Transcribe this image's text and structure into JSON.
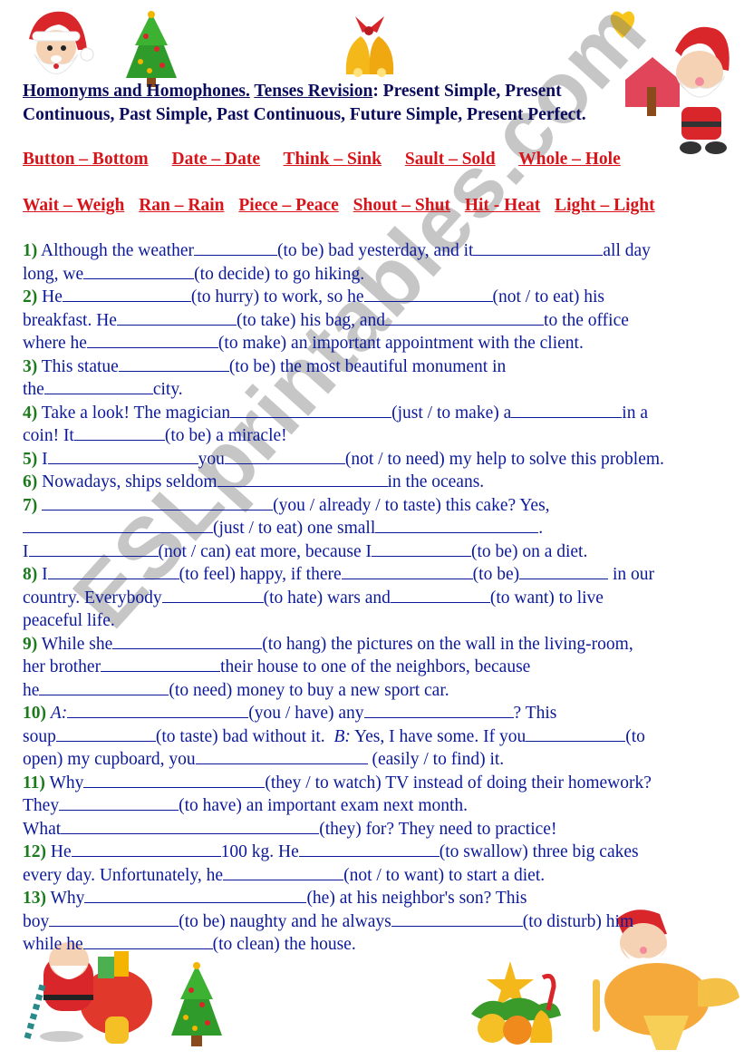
{
  "title": {
    "part1": "Homonyms and Homophones.",
    "part2": "Tenses Revision",
    "part3": ": Present Simple, Present",
    "line2": "Continuous, Past Simple, Past Continuous, Future Simple, Present Perfect."
  },
  "word_pairs": {
    "row1": [
      "Button – Bottom",
      "Date – Date",
      "Think – Sink",
      "Sault – Sold",
      "Whole – Hole"
    ],
    "row2": [
      "Wait – Weigh",
      "Ran – Rain",
      "Piece – Peace",
      "Shout – Shut",
      "Hit - Heat",
      "Light – Light"
    ]
  },
  "watermark": "ESLprintables.com",
  "exercises": {
    "l1": {
      "num": "1)",
      "a": " Although the weather",
      "b": "(to be) bad yesterday, and it",
      "c": "all day"
    },
    "l2": {
      "a": "long, we",
      "b": "(to decide) to go hiking."
    },
    "l3": {
      "num": "2)",
      "a": " He",
      "b": "(to hurry) to work, so he",
      "c": "(not / to eat) his"
    },
    "l4": {
      "a": "breakfast. He",
      "b": "(to take) his bag, and",
      "c": "to the office"
    },
    "l5": {
      "a": "where he",
      "b": "(to make) an important appointment with the client."
    },
    "l6": {
      "num": "3)",
      "a": " This statue",
      "b": "(to be) the most beautiful monument in"
    },
    "l7": {
      "a": "the",
      "b": "city."
    },
    "l8": {
      "num": "4)",
      "a": " Take a look! The magician",
      "b": "(just / to make) a",
      "c": "in a"
    },
    "l9": {
      "a": "coin! It",
      "b": "(to be) a miracle!"
    },
    "l10": {
      "num": "5)",
      "a": " I",
      "b": "you",
      "c": "(not / to need) my help to solve this problem."
    },
    "l11": {
      "num": "6)",
      "a": " Nowadays, ships seldom",
      "b": "in the oceans."
    },
    "l12": {
      "num": "7)",
      "a": " ",
      "b": "(you / already / to taste) this cake? Yes,"
    },
    "l13": {
      "a": "(just / to eat) one small",
      "b": "."
    },
    "l14": {
      "a": "I",
      "b": "(not / can) eat more, because I",
      "c": "(to be) on a diet."
    },
    "l15": {
      "num": "8)",
      "a": " I",
      "b": "(to feel) happy, if there",
      "c": "(to be)",
      "d": " in our"
    },
    "l16": {
      "a": "country. Everybody",
      "b": "(to hate) wars and",
      "c": "(to want) to live"
    },
    "l17": {
      "a": "peaceful life."
    },
    "l18": {
      "num": "9)",
      "a": " While she",
      "b": "(to hang) the pictures on the wall in the living-room,"
    },
    "l19": {
      "a": "her brother",
      "b": "their house to one of the neighbors, because"
    },
    "l20": {
      "a": "he",
      "b": "(to need) money to buy a new sport car."
    },
    "l21": {
      "num": "10)",
      "speakerA": "A:",
      "b": "(you / have) any",
      "c": "? This"
    },
    "l22": {
      "a": "soup",
      "b": "(to taste) bad without it.  ",
      "speakerB": "B:",
      "c": " Yes, I have some. If you",
      "d": "(to"
    },
    "l23": {
      "a": "open) my cupboard, you",
      "b": " (easily / to find) it."
    },
    "l24": {
      "num": "11)",
      "a": " Why",
      "b": "(they / to watch) TV instead of doing their homework?"
    },
    "l25": {
      "a": "They",
      "b": "(to have) an important exam next month."
    },
    "l26": {
      "a": "What",
      "b": "(they) for? They need to practice!"
    },
    "l27": {
      "num": "12)",
      "a": " He",
      "b": "100 kg. He",
      "c": "(to swallow) three big cakes"
    },
    "l28": {
      "a": "every day. Unfortunately, he",
      "b": "(not / to want) to start a diet."
    },
    "l29": {
      "num": "13)",
      "a": " Why",
      "b": "(he) at his neighbor's son? This"
    },
    "l30": {
      "a": "boy",
      "b": "(to be) naughty and he always",
      "c": "(to disturb) him"
    },
    "l31": {
      "a": "while he",
      "b": "(to clean) the house."
    }
  },
  "decorations": [
    "santa-icon",
    "christmas-tree-icon",
    "bells-icon",
    "heart-icon",
    "santa-house-icon",
    "santa-gift-bag-icon",
    "christmas-tree-icon",
    "ornaments-icon",
    "santa-airplane-icon"
  ]
}
